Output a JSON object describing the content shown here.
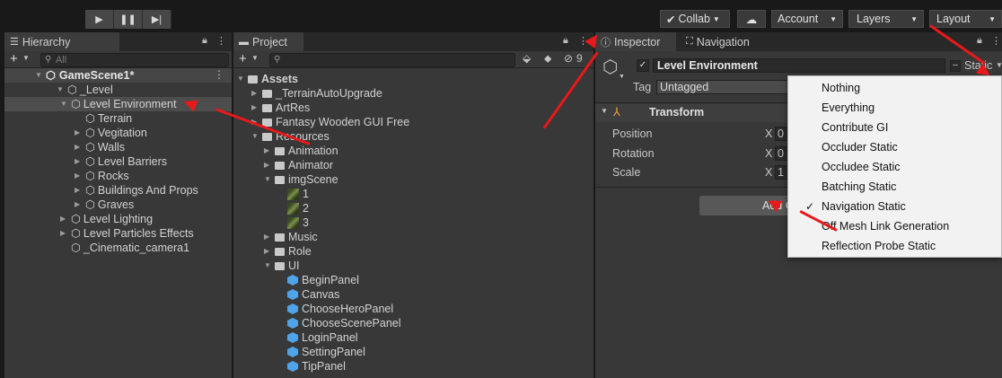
{
  "toolbar": {
    "play_icon": "play-icon",
    "pause_icon": "pause-icon",
    "step_icon": "step-icon",
    "collab_label": "Collab",
    "account_label": "Account",
    "layers_label": "Layers",
    "layout_label": "Layout"
  },
  "hierarchy": {
    "tab_label": "Hierarchy",
    "search_placeholder": "All",
    "add_label": "+",
    "scene_name": "GameScene1*",
    "items": [
      {
        "label": "_Level"
      },
      {
        "label": "Level Environment"
      },
      {
        "label": "Terrain"
      },
      {
        "label": "Vegitation"
      },
      {
        "label": "Walls"
      },
      {
        "label": "Level Barriers"
      },
      {
        "label": "Rocks"
      },
      {
        "label": "Buildings And Props"
      },
      {
        "label": "Graves"
      },
      {
        "label": "Level Lighting"
      },
      {
        "label": "Level Particles Effects"
      },
      {
        "label": "_Cinematic_camera1"
      }
    ]
  },
  "project": {
    "tab_label": "Project",
    "add_label": "+",
    "hidden_count": "9",
    "items": [
      {
        "label": "Assets"
      },
      {
        "label": "_TerrainAutoUpgrade"
      },
      {
        "label": "ArtRes"
      },
      {
        "label": "Fantasy Wooden GUI  Free"
      },
      {
        "label": "Resources"
      },
      {
        "label": "Animation"
      },
      {
        "label": "Animator"
      },
      {
        "label": "imgScene"
      },
      {
        "label": "1"
      },
      {
        "label": "2"
      },
      {
        "label": "3"
      },
      {
        "label": "Music"
      },
      {
        "label": "Role"
      },
      {
        "label": "UI"
      },
      {
        "label": "BeginPanel"
      },
      {
        "label": "Canvas"
      },
      {
        "label": "ChooseHeroPanel"
      },
      {
        "label": "ChooseScenePanel"
      },
      {
        "label": "LoginPanel"
      },
      {
        "label": "SettingPanel"
      },
      {
        "label": "TipPanel"
      }
    ]
  },
  "inspector": {
    "tab_label": "Inspector",
    "nav_tab_label": "Navigation",
    "object_name": "Level Environment",
    "static_label": "Static",
    "tag_label": "Tag",
    "tag_value": "Untagged",
    "transform_label": "Transform",
    "position_label": "Position",
    "rotation_label": "Rotation",
    "scale_label": "Scale",
    "axis_x": "X",
    "pos_x": "0",
    "rot_x": "0",
    "scale_x": "1",
    "add_component_label": "Add C"
  },
  "static_dropdown": {
    "options": [
      {
        "label": "Nothing",
        "checked": false
      },
      {
        "label": "Everything",
        "checked": false
      },
      {
        "label": "Contribute GI",
        "checked": false
      },
      {
        "label": "Occluder Static",
        "checked": false
      },
      {
        "label": "Occludee Static",
        "checked": false
      },
      {
        "label": "Batching Static",
        "checked": false
      },
      {
        "label": "Navigation Static",
        "checked": true
      },
      {
        "label": "Off Mesh Link Generation",
        "checked": false
      },
      {
        "label": "Reflection Probe Static",
        "checked": false
      }
    ],
    "check_glyph": "✓"
  },
  "colors": {
    "annotation_arrow": "#e7191a",
    "selection": "#4a4a4a",
    "prefab_blue": "#4fa3e6"
  }
}
